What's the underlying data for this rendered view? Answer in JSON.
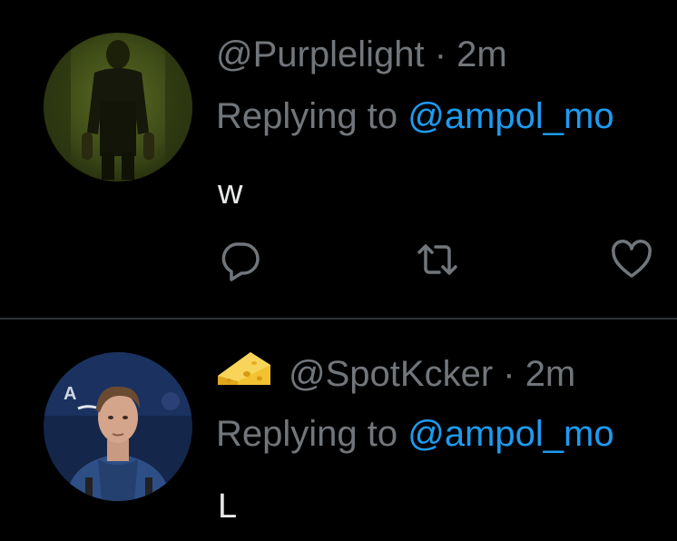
{
  "colors": {
    "background": "#000000",
    "primary_text": "#e7e9ea",
    "secondary_text": "#71767b",
    "link": "#1d9bf0",
    "divider": "#2f3336"
  },
  "tweets": [
    {
      "handle": "@Purplelight",
      "separator": " · ",
      "time": "2m",
      "replying_prefix": "Replying to ",
      "replying_to": "@ampol_mo",
      "text": "w",
      "avatar_icon": "avatar-dark-figure",
      "actions": [
        "reply-icon",
        "retweet-icon",
        "like-icon"
      ]
    },
    {
      "name_emoji_icon": "cheese-icon",
      "handle": "@SpotKcker",
      "separator": " · ",
      "time": "2m",
      "replying_prefix": "Replying to ",
      "replying_to": "@ampol_mo",
      "text": "L",
      "avatar_icon": "avatar-player-photo"
    }
  ]
}
